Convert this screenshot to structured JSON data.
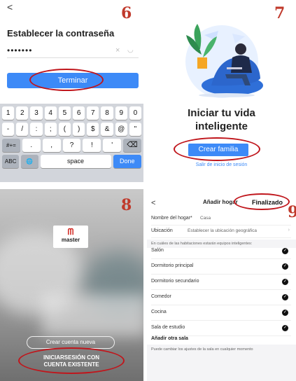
{
  "steps": [
    "6",
    "7",
    "8",
    "9"
  ],
  "panel6": {
    "back": "<",
    "title": "Establecer la contraseña",
    "password_value": "•••••••",
    "clear_icon": "×",
    "eye_icon": "◡",
    "submit_label": "Terminar",
    "keyboard_rows": [
      [
        "1",
        "2",
        "3",
        "4",
        "5",
        "6",
        "7",
        "8",
        "9",
        "0"
      ],
      [
        "-",
        "/",
        ":",
        ";",
        "(",
        ")",
        "$",
        "&",
        "@",
        "\""
      ],
      [
        "#+=",
        ".",
        ",",
        "?",
        "!",
        "'",
        "⌫"
      ],
      [
        "ABC",
        "🌐",
        "space",
        "Done"
      ]
    ]
  },
  "panel7": {
    "headline_line1": "Iniciar tu vida",
    "headline_line2": "inteligente",
    "create_family": "Crear familia",
    "logout": "Salir de inicio de sesión"
  },
  "panel8": {
    "logo_mark": "ᗰ",
    "logo_word": "master",
    "create_account": "Crear cuenta nueva",
    "login_line1": "INICIARSESIÓN CON",
    "login_line2": "CUENTA EXISTENTE"
  },
  "panel9": {
    "back": "<",
    "title": "Añadir hogar",
    "done": "Finalizado",
    "home_name_label": "Nombre del hogar*",
    "home_name_value": "Casa",
    "location_label": "Ubicación",
    "location_value": "Establecer la ubicación geográfica",
    "rooms_hint": "En cuáles de las habitaciones estarán equipos inteligentes:",
    "rooms": [
      "Salón",
      "Dormitorio principal",
      "Dormitorio secundario",
      "Comedor",
      "Cocina",
      "Sala de estudio"
    ],
    "add_room": "Añadir otra sala",
    "footer_note": "Puede cambiar los ajustes de la sala en cualquier momento"
  }
}
